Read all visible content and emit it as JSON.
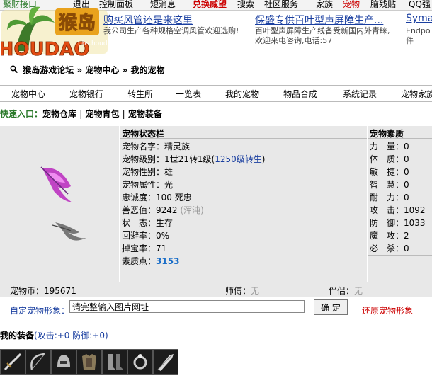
{
  "top_menu": [
    "聚财接口",
    "退出",
    "控制面板",
    "短消息",
    "兑换威望",
    "搜索",
    "社区服务",
    "家族",
    "宠物",
    "脑残贴",
    "QQ强"
  ],
  "logo": {
    "text": "HOUDAO",
    "site_cn": "猴岛",
    "url_text": "bbs.houdao.com"
  },
  "ads": [
    {
      "title": "购买风管还是来这里",
      "desc": "我公司生产各种规格空调风管欢迎选购!"
    },
    {
      "title": "保盛专供百叶型声屏障生产...",
      "desc": "百叶型声屏障生产线备受新国内外青睐,欢迎来电咨询,电话:57"
    },
    {
      "title": "Symar",
      "desc": "Endpo件"
    }
  ],
  "breadcrumb": [
    "猴岛游戏论坛",
    "宠物中心",
    "我的宠物"
  ],
  "breadcrumb_sep": "»",
  "nav": [
    "宠物中心",
    "宠物银行",
    "转生所",
    "一览表",
    "我的宠物",
    "物品合成",
    "系统记录",
    "宠物家族"
  ],
  "quick_entry": {
    "label": "快速入口：",
    "links": [
      "宠物仓库",
      "宠物青包",
      "宠物装备"
    ],
    "sep": "|"
  },
  "status": {
    "header": "宠物状态栏",
    "name_label": "宠物名字：",
    "name": "精灵族",
    "level_label": "宠物级别：",
    "level": "1世21转1级(",
    "level_link": "1250级转生",
    "level_close": ")",
    "gender_label": "宠物性别：",
    "gender": "雄",
    "attr_label": "宠物属性：",
    "attr": "光",
    "loyalty_label": "忠诚度：",
    "loyalty": "100 死忠",
    "karma_label": "善恶值：",
    "karma": "9242",
    "karma_note": "(浑沌)",
    "state_label": "状　态：",
    "state": "生存",
    "dodge_label": "回避率：",
    "dodge": "0%",
    "drop_label": "掉宝率：",
    "drop": "71",
    "points_label": "素质点：",
    "points": "3153"
  },
  "quality": {
    "header": "宠物素质",
    "items": [
      {
        "label": "力　量：",
        "value": "0"
      },
      {
        "label": "体　质：",
        "value": "0"
      },
      {
        "label": "敏　捷：",
        "value": "0"
      },
      {
        "label": "智　慧：",
        "value": "0"
      },
      {
        "label": "耐　力：",
        "value": "0"
      },
      {
        "label": "攻　击：",
        "value": "1092"
      },
      {
        "label": "防　御：",
        "value": "1033"
      },
      {
        "label": "魔　攻：",
        "value": "2"
      },
      {
        "label": "必　杀：",
        "value": "0"
      }
    ]
  },
  "coin_row": {
    "coin_label": "宠物币：",
    "coin": "195671",
    "master_label": "师傅：",
    "master": "无",
    "partner_label": "伴侣：",
    "partner": "无"
  },
  "custom_image": {
    "label": "自定宠物形象：",
    "input_value": "请完整输入图片网址",
    "confirm": "确 定",
    "restore": "还原宠物形象"
  },
  "equipment": {
    "title": "我的装备",
    "stats": "(攻击:+0 防御:+0)",
    "items": [
      "sword-icon",
      "bow-icon",
      "helmet-icon",
      "armor-icon",
      "boots-icon",
      "ring-icon",
      "blade-icon"
    ]
  }
}
